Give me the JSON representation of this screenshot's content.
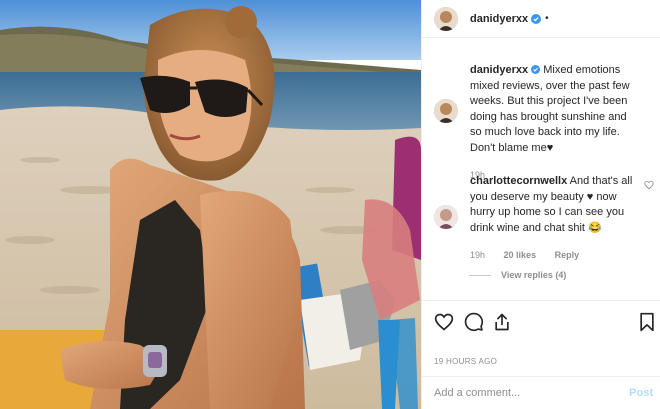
{
  "post": {
    "username": "danidyerxx",
    "dot": "•",
    "caption": "Mixed emotions mixed reviews, over the past few weeks. But this project I've been doing has brought sunshine and so much love back into my life. Don't blame me♥",
    "caption_time": "19h",
    "timestamp": "19 HOURS AGO"
  },
  "comment": {
    "username": "charlottecornwellx",
    "text": "And that's all you deserve my beauty ♥ now hurry up home so I can see you drink wine and chat shit 😂",
    "time": "19h",
    "likes": "20 likes",
    "reply_label": "Reply",
    "view_replies": "View replies (4)"
  },
  "compose": {
    "placeholder": "Add a comment...",
    "post_label": "Post"
  },
  "icons": {
    "verified": "verified-badge-icon",
    "like": "heart-icon",
    "comment": "comment-bubble-icon",
    "share": "share-icon",
    "save": "bookmark-icon",
    "comment_like": "heart-icon"
  },
  "colors": {
    "verified": "#3897f0",
    "post_disabled": "#b2dffc",
    "muted": "#8e8e8e"
  }
}
